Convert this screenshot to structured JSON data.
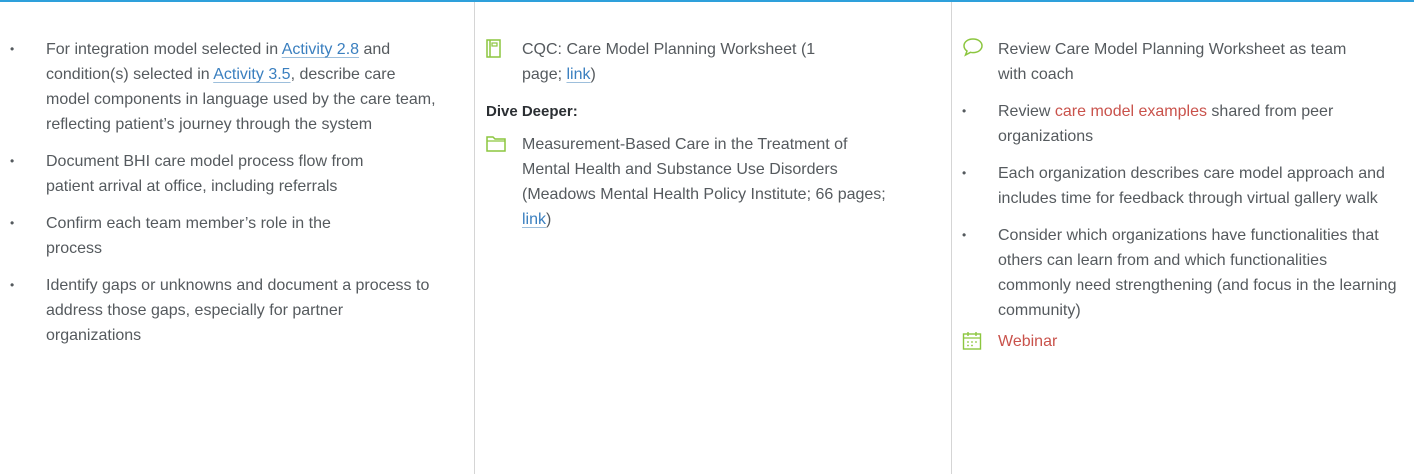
{
  "colors": {
    "accent_rule": "#2ea0db",
    "link_blue": "#3a7fbf",
    "link_red": "#c9524b",
    "icon_green": "#8cc63f"
  },
  "column1": {
    "item1": {
      "pre": "For integration model selected in ",
      "link1": "Activity 2.8",
      "mid": " and condition(s) selected in ",
      "link2": "Activity 3.5",
      "post": ", describe care model components in language used by the care team, reflecting patient’s journey through the system"
    },
    "item2": "Document BHI care model process flow from patient arrival at office, including referrals",
    "item3": "Confirm each team member’s role in the process",
    "item4": "Identify gaps or unknowns and document a process to address those gaps, especially for partner organizations"
  },
  "column2": {
    "worksheet": {
      "text": "CQC: Care Model Planning Worksheet (1 page; ",
      "link": "link",
      "close": ")",
      "icon": "document-icon"
    },
    "dive_heading": "Dive Deeper:",
    "resource": {
      "text": "Measurement-Based Care in the Treatment of Mental Health and Substance Use Disorders (Meadows Mental Health Policy Institute; 66 pages; ",
      "link": "link",
      "close": ")",
      "icon": "folder-icon"
    }
  },
  "column3": {
    "review": {
      "text": "Review Care Model Planning Worksheet as team with coach",
      "icon": "speech-bubble-icon"
    },
    "item1": {
      "pre": "Review ",
      "link": "care model examples",
      "post": " shared from peer organizations"
    },
    "item2": "Each organization describes care model approach and includes time for feedback through virtual gallery walk",
    "item3": "Consider which organizations have functionalities that others can learn from and which functionalities commonly need strengthening (and focus in the learning community)",
    "webinar": {
      "label": "Webinar",
      "icon": "calendar-icon"
    }
  }
}
